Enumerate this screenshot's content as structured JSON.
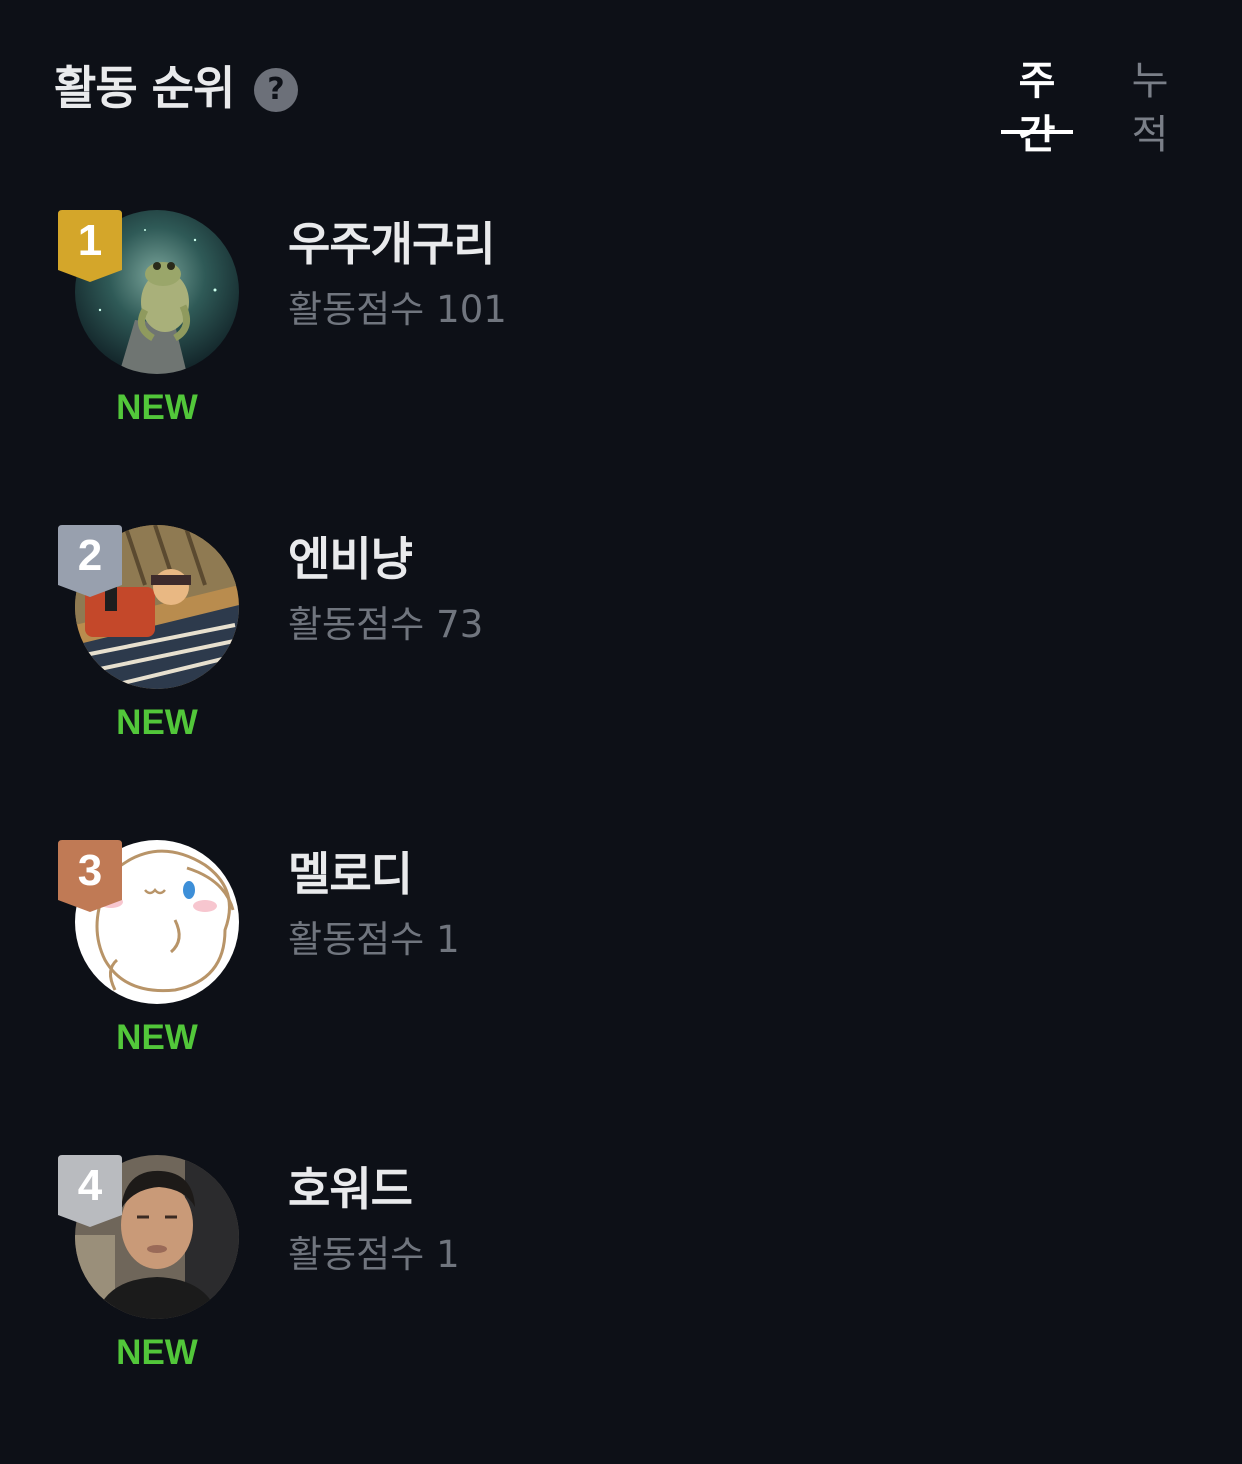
{
  "header": {
    "title": "활동 순위",
    "help_icon": "question-mark",
    "tabs": [
      {
        "label": "주간",
        "active": true
      },
      {
        "label": "누적",
        "active": false
      }
    ]
  },
  "colors": {
    "background": "#0d1017",
    "new_label": "#52c73a",
    "rank_gold": "#d4a62a",
    "rank_silver": "#98a0ae",
    "rank_bronze": "#c07a55",
    "rank_default": "#b9bbbf"
  },
  "ranking": [
    {
      "rank": "1",
      "name": "우주개구리",
      "score_label": "활동점수",
      "score": "101",
      "status": "NEW",
      "avatar": "frog-in-space"
    },
    {
      "rank": "2",
      "name": "엔비냥",
      "score_label": "활동점수",
      "score": "73",
      "status": "NEW",
      "avatar": "cartoon-character"
    },
    {
      "rank": "3",
      "name": "멜로디",
      "score_label": "활동점수",
      "score": "1",
      "status": "NEW",
      "avatar": "white-bunny"
    },
    {
      "rank": "4",
      "name": "호워드",
      "score_label": "활동점수",
      "score": "1",
      "status": "NEW",
      "avatar": "person-photo"
    }
  ]
}
